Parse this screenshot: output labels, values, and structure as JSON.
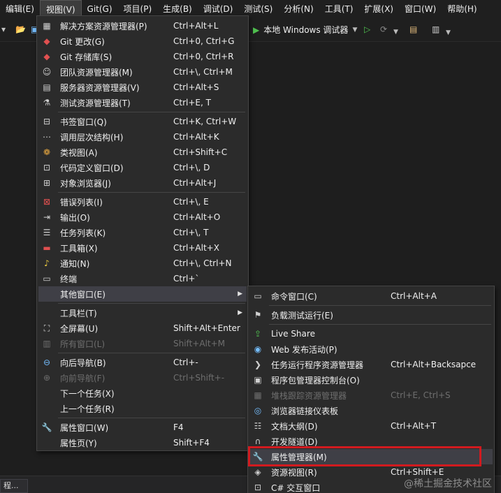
{
  "menubar": [
    "编辑(E)",
    "视图(V)",
    "Git(G)",
    "项目(P)",
    "生成(B)",
    "调试(D)",
    "测试(S)",
    "分析(N)",
    "工具(T)",
    "扩展(X)",
    "窗口(W)",
    "帮助(H)"
  ],
  "toolbar": {
    "debug_label": "本地 Windows 调试器"
  },
  "view_menu": [
    {
      "icon": "▦",
      "icon_name": "solution-explorer-icon",
      "label": "解决方案资源管理器(P)",
      "shortcut": "Ctrl+Alt+L"
    },
    {
      "icon": "◆",
      "icon_name": "git-changes-icon",
      "label": "Git 更改(G)",
      "shortcut": "Ctrl+0, Ctrl+G"
    },
    {
      "icon": "◆",
      "icon_name": "git-repository-icon",
      "label": "Git 存储库(S)",
      "shortcut": "Ctrl+0, Ctrl+R"
    },
    {
      "icon": "☺",
      "icon_name": "team-explorer-icon",
      "label": "团队资源管理器(M)",
      "shortcut": "Ctrl+\\, Ctrl+M"
    },
    {
      "icon": "▤",
      "icon_name": "server-explorer-icon",
      "label": "服务器资源管理器(V)",
      "shortcut": "Ctrl+Alt+S"
    },
    {
      "icon": "⚗",
      "icon_name": "test-explorer-icon",
      "label": "测试资源管理器(T)",
      "shortcut": "Ctrl+E, T"
    },
    {
      "icon": "⊟",
      "icon_name": "bookmark-window-icon",
      "label": "书签窗口(Q)",
      "shortcut": "Ctrl+K, Ctrl+W"
    },
    {
      "icon": "⋯",
      "icon_name": "call-hierarchy-icon",
      "label": "调用层次结构(H)",
      "shortcut": "Ctrl+Alt+K"
    },
    {
      "icon": "❁",
      "icon_name": "class-view-icon",
      "label": "类视图(A)",
      "shortcut": "Ctrl+Shift+C"
    },
    {
      "icon": "⊡",
      "icon_name": "code-definition-icon",
      "label": "代码定义窗口(D)",
      "shortcut": "Ctrl+\\, D"
    },
    {
      "icon": "⊞",
      "icon_name": "object-browser-icon",
      "label": "对象浏览器(J)",
      "shortcut": "Ctrl+Alt+J"
    },
    {
      "icon": "⊠",
      "icon_name": "error-list-icon",
      "label": "错误列表(I)",
      "shortcut": "Ctrl+\\, E"
    },
    {
      "icon": "⇥",
      "icon_name": "output-icon",
      "label": "输出(O)",
      "shortcut": "Ctrl+Alt+O"
    },
    {
      "icon": "☰",
      "icon_name": "task-list-icon",
      "label": "任务列表(K)",
      "shortcut": "Ctrl+\\, T"
    },
    {
      "icon": "▬",
      "icon_name": "toolbox-icon",
      "label": "工具箱(X)",
      "shortcut": "Ctrl+Alt+X"
    },
    {
      "icon": "♪",
      "icon_name": "notifications-icon",
      "label": "通知(N)",
      "shortcut": "Ctrl+\\, Ctrl+N"
    },
    {
      "icon": "▭",
      "icon_name": "terminal-icon",
      "label": "终端",
      "shortcut": "Ctrl+`"
    },
    {
      "icon": "",
      "icon_name": "",
      "label": "其他窗口(E)",
      "shortcut": "",
      "submenu": true
    },
    {
      "icon": "",
      "icon_name": "",
      "label": "工具栏(T)",
      "shortcut": "",
      "submenu": true
    },
    {
      "icon": "⛶",
      "icon_name": "full-screen-icon",
      "label": "全屏幕(U)",
      "shortcut": "Shift+Alt+Enter"
    },
    {
      "icon": "▥",
      "icon_name": "all-windows-icon",
      "label": "所有窗口(L)",
      "shortcut": "Shift+Alt+M",
      "disabled": true
    },
    {
      "icon": "⊖",
      "icon_name": "navigate-back-icon",
      "label": "向后导航(B)",
      "shortcut": "Ctrl+-"
    },
    {
      "icon": "⊕",
      "icon_name": "navigate-forward-icon",
      "label": "向前导航(F)",
      "shortcut": "Ctrl+Shift+-",
      "disabled": true
    },
    {
      "icon": "",
      "icon_name": "",
      "label": "下一个任务(X)",
      "shortcut": ""
    },
    {
      "icon": "",
      "icon_name": "",
      "label": "上一个任务(R)",
      "shortcut": ""
    },
    {
      "icon": "🔧",
      "icon_name": "properties-window-icon",
      "label": "属性窗口(W)",
      "shortcut": "F4"
    },
    {
      "icon": "",
      "icon_name": "",
      "label": "属性页(Y)",
      "shortcut": "Shift+F4"
    }
  ],
  "other_windows_menu": [
    {
      "icon": "▭",
      "icon_name": "command-window-icon",
      "label": "命令窗口(C)",
      "shortcut": "Ctrl+Alt+A"
    },
    {
      "icon": "⚑",
      "icon_name": "load-test-icon",
      "label": "负载测试运行(E)",
      "shortcut": ""
    },
    {
      "icon": "⇪",
      "icon_name": "live-share-icon",
      "label": "Live Share",
      "shortcut": ""
    },
    {
      "icon": "◉",
      "icon_name": "web-publish-icon",
      "label": "Web 发布活动(P)",
      "shortcut": ""
    },
    {
      "icon": "❯",
      "icon_name": "task-runner-icon",
      "label": "任务运行程序资源管理器",
      "shortcut": "Ctrl+Alt+Backsapce"
    },
    {
      "icon": "▣",
      "icon_name": "package-manager-console-icon",
      "label": "程序包管理器控制台(O)",
      "shortcut": ""
    },
    {
      "icon": "▦",
      "icon_name": "stack-trace-explorer-icon",
      "label": "堆栈跟踪资源管理器",
      "shortcut": "Ctrl+E, Ctrl+S",
      "disabled": true
    },
    {
      "icon": "◎",
      "icon_name": "browser-link-icon",
      "label": "浏览器链接仪表板",
      "shortcut": ""
    },
    {
      "icon": "☷",
      "icon_name": "document-outline-icon",
      "label": "文档大纲(D)",
      "shortcut": "Ctrl+Alt+T"
    },
    {
      "icon": "∩",
      "icon_name": "dev-tunnels-icon",
      "label": "开发隧道(D)",
      "shortcut": ""
    },
    {
      "icon": "🔧",
      "icon_name": "property-manager-icon",
      "label": "属性管理器(M)",
      "shortcut": ""
    },
    {
      "icon": "◈",
      "icon_name": "resource-view-icon",
      "label": "资源视图(R)",
      "shortcut": "Ctrl+Shift+E"
    },
    {
      "icon": "⊡",
      "icon_name": "csharp-interactive-icon",
      "label": "C# 交互窗口",
      "shortcut": ""
    }
  ],
  "bottom": {
    "tab": "程..."
  },
  "watermark": "@稀土掘金技术社区"
}
